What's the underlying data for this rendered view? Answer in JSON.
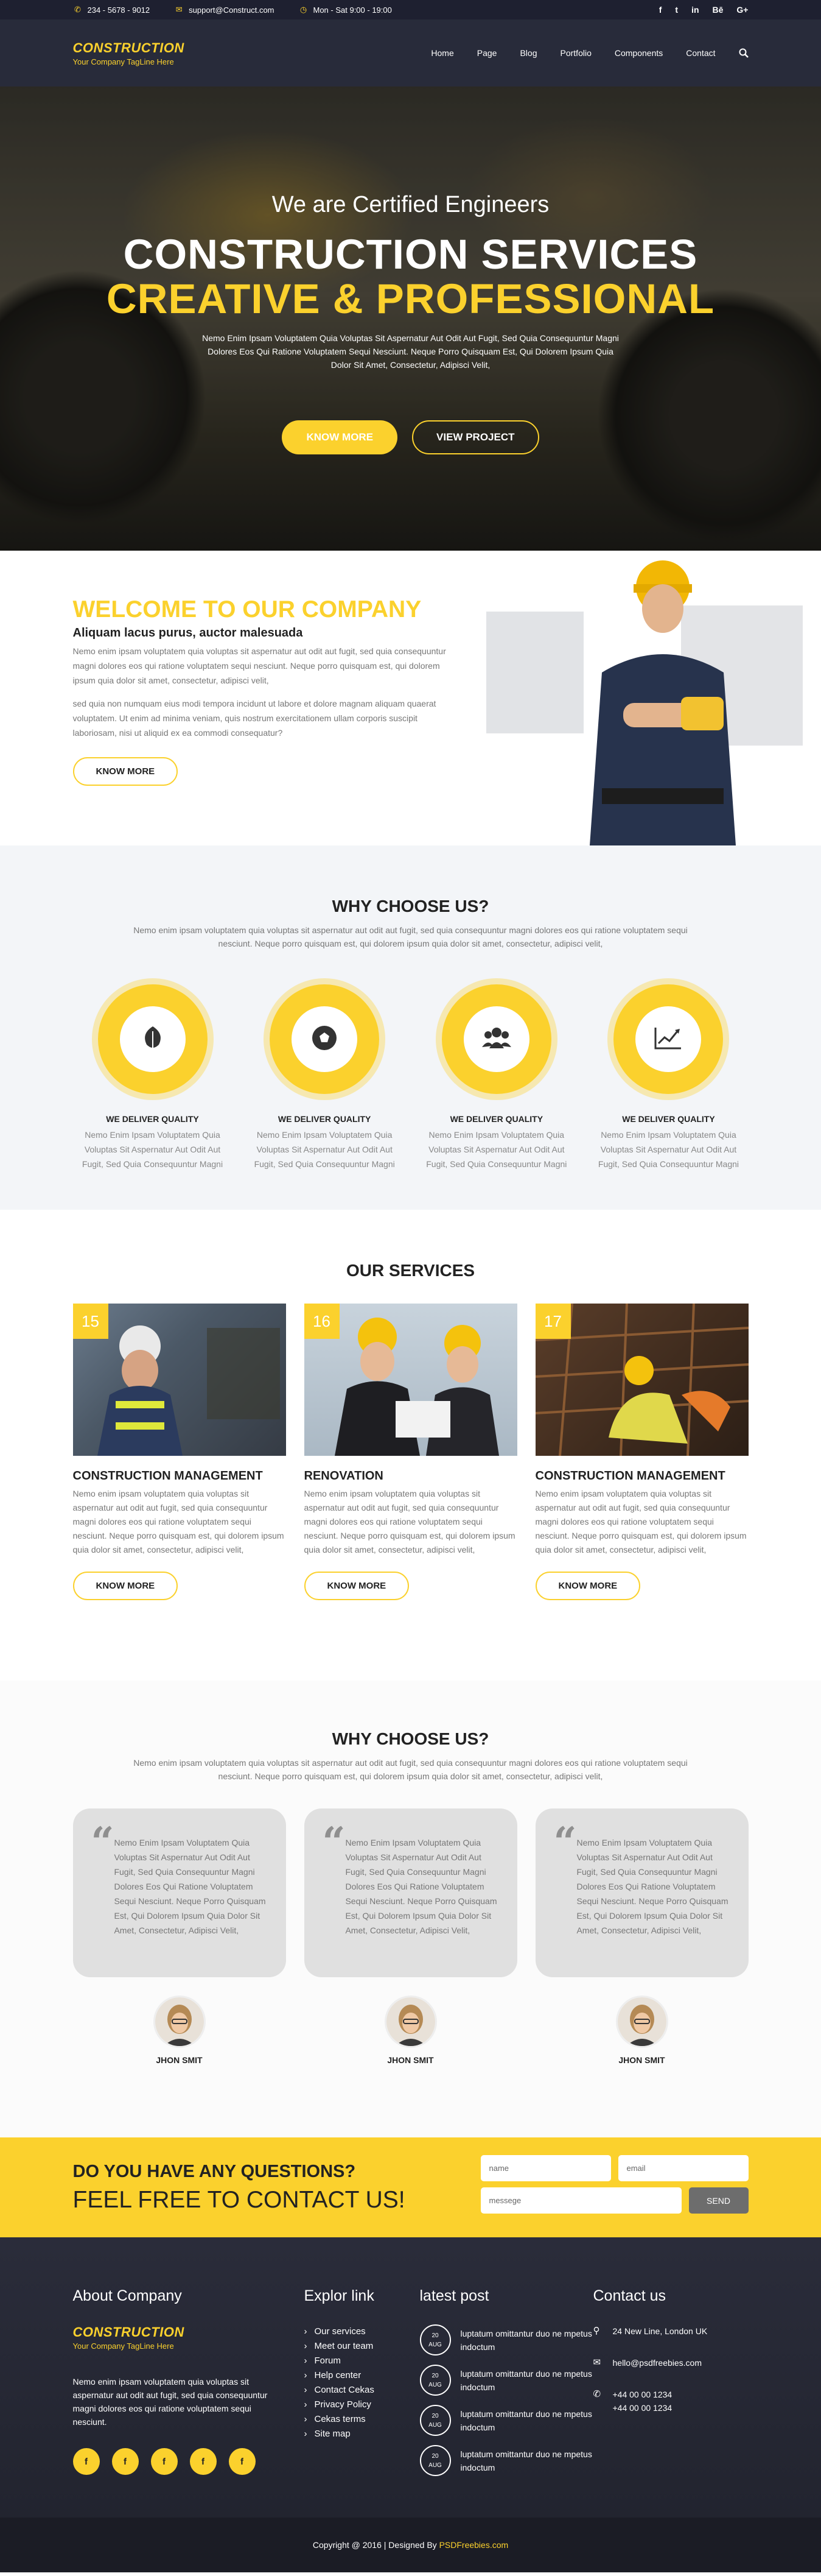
{
  "topbar": {
    "phone": "234 - 5678 - 9012",
    "email": "support@Construct.com",
    "hours": "Mon - Sat 9:00 - 19:00",
    "social": [
      "f",
      "t",
      "in",
      "Bē",
      "G+"
    ]
  },
  "header": {
    "logo_title": "CONSTRUCTION",
    "logo_tagline": "Your Company TagLine Here",
    "nav": [
      "Home",
      "Page",
      "Blog",
      "Portfolio",
      "Components",
      "Contact"
    ]
  },
  "hero": {
    "subtitle": "We are Certified Engineers",
    "title1": "CONSTRUCTION SERVICES",
    "title2": "CREATIVE & PROFESSIONAL",
    "text": "Nemo Enim Ipsam Voluptatem Quia Voluptas Sit Aspernatur Aut Odit Aut Fugit, Sed Quia Consequuntur Magni Dolores Eos Qui Ratione Voluptatem Sequi Nesciunt. Neque Porro Quisquam Est, Qui Dolorem Ipsum Quia Dolor Sit Amet, Consectetur, Adipisci Velit,",
    "btn1": "KNOW MORE",
    "btn2": "VIEW PROJECT"
  },
  "welcome": {
    "title": "WELCOME TO OUR COMPANY",
    "subtitle": "Aliquam lacus purus, auctor malesuada",
    "p1": "Nemo enim ipsam voluptatem quia voluptas sit aspernatur aut odit aut fugit, sed quia consequuntur magni dolores eos qui ratione voluptatem sequi nesciunt. Neque porro quisquam est, qui dolorem ipsum quia dolor sit amet, consectetur, adipisci velit,",
    "p2": "sed quia non numquam eius modi tempora incidunt ut labore et dolore magnam aliquam quaerat voluptatem. Ut enim ad minima veniam, quis nostrum exercitationem ullam corporis suscipit laboriosam, nisi ut aliquid ex ea commodi consequatur?",
    "button": "KNOW MORE"
  },
  "why": {
    "title": "WHY CHOOSE US?",
    "text": "Nemo enim ipsam voluptatem quia voluptas sit aspernatur aut odit aut fugit, sed quia consequuntur magni dolores eos qui ratione voluptatem sequi nesciunt. Neque porro quisquam est, qui dolorem ipsum quia dolor sit amet, consectetur, adipisci velit,",
    "features": [
      {
        "icon": "leaf-icon",
        "title": "WE DELIVER QUALITY",
        "text": "Nemo Enim Ipsam Voluptatem Quia Voluptas Sit Aspernatur Aut Odit Aut Fugit, Sed Quia Consequuntur Magni"
      },
      {
        "icon": "soccer-ball-icon",
        "title": "WE DELIVER QUALITY",
        "text": "Nemo Enim Ipsam Voluptatem Quia Voluptas Sit Aspernatur Aut Odit Aut Fugit, Sed Quia Consequuntur Magni"
      },
      {
        "icon": "group-icon",
        "title": "WE DELIVER QUALITY",
        "text": "Nemo Enim Ipsam Voluptatem Quia Voluptas Sit Aspernatur Aut Odit Aut Fugit, Sed Quia Consequuntur Magni"
      },
      {
        "icon": "chart-icon",
        "title": "WE DELIVER QUALITY",
        "text": "Nemo Enim Ipsam Voluptatem Quia Voluptas Sit Aspernatur Aut Odit Aut Fugit, Sed Quia Consequuntur Magni"
      }
    ]
  },
  "services": {
    "title": "OUR SERVICES",
    "items": [
      {
        "num": "15",
        "title": "CONSTRUCTION MANAGEMENT",
        "text": "Nemo enim ipsam voluptatem quia voluptas sit aspernatur aut odit aut fugit, sed quia consequuntur magni dolores eos qui ratione voluptatem sequi nesciunt. Neque porro quisquam est, qui dolorem ipsum quia dolor sit amet, consectetur, adipisci velit,",
        "button": "KNOW MORE"
      },
      {
        "num": "16",
        "title": "RENOVATION",
        "text": "Nemo enim ipsam voluptatem quia voluptas sit aspernatur aut odit aut fugit, sed quia consequuntur magni dolores eos qui ratione voluptatem sequi nesciunt. Neque porro quisquam est, qui dolorem ipsum quia dolor sit amet, consectetur, adipisci velit,",
        "button": "KNOW MORE"
      },
      {
        "num": "17",
        "title": "CONSTRUCTION MANAGEMENT",
        "text": "Nemo enim ipsam voluptatem quia voluptas sit aspernatur aut odit aut fugit, sed quia consequuntur magni dolores eos qui ratione voluptatem sequi nesciunt. Neque porro quisquam est, qui dolorem ipsum quia dolor sit amet, consectetur, adipisci velit,",
        "button": "KNOW MORE"
      }
    ]
  },
  "testimonials": {
    "title": "WHY CHOOSE US?",
    "text": "Nemo enim ipsam voluptatem quia voluptas sit aspernatur aut odit aut fugit, sed quia consequuntur magni dolores eos qui ratione voluptatem sequi nesciunt. Neque porro quisquam est, qui dolorem ipsum quia dolor sit amet, consectetur, adipisci velit,",
    "items": [
      {
        "quote": "Nemo Enim Ipsam Voluptatem Quia Voluptas Sit Aspernatur Aut Odit Aut Fugit, Sed Quia Consequuntur Magni Dolores Eos Qui Ratione Voluptatem Sequi Nesciunt. Neque Porro Quisquam Est, Qui Dolorem Ipsum Quia Dolor Sit Amet, Consectetur, Adipisci Velit,",
        "name": "JHON SMIT"
      },
      {
        "quote": "Nemo Enim Ipsam Voluptatem Quia Voluptas Sit Aspernatur Aut Odit Aut Fugit, Sed Quia Consequuntur Magni Dolores Eos Qui Ratione Voluptatem Sequi Nesciunt. Neque Porro Quisquam Est, Qui Dolorem Ipsum Quia Dolor Sit Amet, Consectetur, Adipisci Velit,",
        "name": "JHON SMIT"
      },
      {
        "quote": "Nemo Enim Ipsam Voluptatem Quia Voluptas Sit Aspernatur Aut Odit Aut Fugit, Sed Quia Consequuntur Magni Dolores Eos Qui Ratione Voluptatem Sequi Nesciunt. Neque Porro Quisquam Est, Qui Dolorem Ipsum Quia Dolor Sit Amet, Consectetur, Adipisci Velit,",
        "name": "JHON SMIT"
      }
    ]
  },
  "contact": {
    "title1": "DO YOU HAVE ANY QUESTIONS?",
    "title2": "FEEL FREE TO CONTACT US!",
    "name_placeholder": "name",
    "email_placeholder": "email",
    "message_placeholder": "messege",
    "send": "SEND"
  },
  "footer": {
    "about_title": "About Company",
    "logo_title": "CONSTRUCTION",
    "logo_tagline": "Your Company TagLine Here",
    "about_text": "Nemo enim ipsam voluptatem quia voluptas sit aspernatur aut odit aut fugit, sed quia consequuntur magni dolores eos qui ratione voluptatem sequi nesciunt.",
    "social": [
      "f",
      "f",
      "f",
      "f",
      "f"
    ],
    "links_title": "Explor link",
    "links": [
      "Our services",
      "Meet our team",
      "Forum",
      "Help center",
      "Contact Cekas",
      "Privacy Policy",
      "Cekas terms",
      "Site map"
    ],
    "posts_title": "latest post",
    "posts": [
      {
        "day": "20",
        "month": "AUG",
        "text": "luptatum omittantur duo ne mpetus indoctum"
      },
      {
        "day": "20",
        "month": "AUG",
        "text": "luptatum omittantur duo ne mpetus indoctum"
      },
      {
        "day": "20",
        "month": "AUG",
        "text": "luptatum omittantur duo ne mpetus indoctum"
      },
      {
        "day": "20",
        "month": "AUG",
        "text": "luptatum omittantur duo ne mpetus indoctum"
      }
    ],
    "contact_title": "Contact us",
    "address": "24 New Line, London UK",
    "email": "hello@psdfreebies.com",
    "phone1": "+44 00 00 1234",
    "phone2": "+44 00 00 1234"
  },
  "copyright": {
    "text": "Copyright @ 2016 | Designed By",
    "brand": "PSDFreebies.com"
  },
  "colors": {
    "accent": "#fbd12d",
    "dark": "#282b3a"
  }
}
